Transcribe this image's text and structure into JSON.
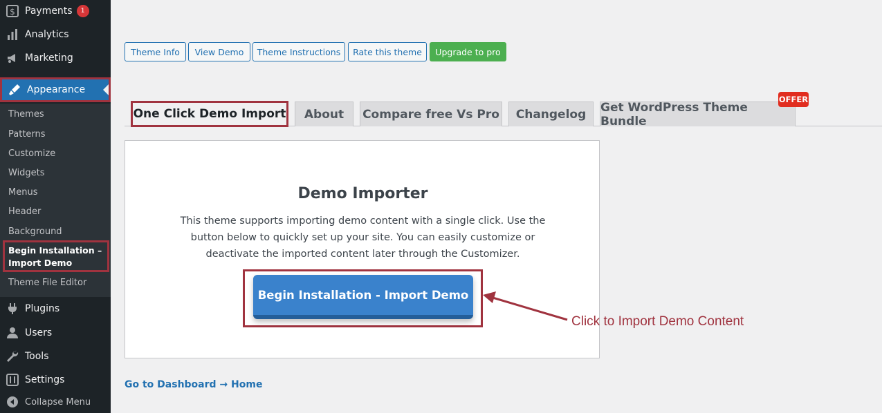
{
  "sidebar": {
    "menu": [
      {
        "label": "Payments",
        "icon": "dollar-icon",
        "badge": "1"
      },
      {
        "label": "Analytics",
        "icon": "bar-chart-icon"
      },
      {
        "label": "Marketing",
        "icon": "megaphone-icon"
      },
      {
        "label": "Appearance",
        "icon": "paintbrush-icon"
      },
      {
        "label": "Plugins",
        "icon": "plug-icon"
      },
      {
        "label": "Users",
        "icon": "user-icon"
      },
      {
        "label": "Tools",
        "icon": "wrench-icon"
      },
      {
        "label": "Settings",
        "icon": "settings-sliders-icon"
      },
      {
        "label": "Collapse Menu",
        "icon": "collapse-icon"
      }
    ],
    "submenu": [
      "Themes",
      "Patterns",
      "Customize",
      "Widgets",
      "Menus",
      "Header",
      "Background",
      "Begin Installation – Import Demo",
      "Theme File Editor"
    ]
  },
  "top_buttons": [
    "Theme Info",
    "View Demo",
    "Theme Instructions",
    "Rate this theme",
    "Upgrade to pro"
  ],
  "tabs": [
    "One Click Demo Import",
    "About",
    "Compare free Vs Pro",
    "Changelog",
    "Get WordPress Theme Bundle"
  ],
  "offer_badge": "OFFER",
  "panel": {
    "title": "Demo Importer",
    "description": "This theme supports importing demo content with a single click. Use the button below to quickly set up your site. You can easily customize or deactivate the imported content later through the Customizer.",
    "cta": "Begin Installation - Import Demo"
  },
  "callout": "Click to Import Demo Content",
  "footer_link": "Go to Dashboard → Home",
  "colors": {
    "accent": "#2271b1",
    "highlight": "#a0333f",
    "upgrade": "#4caf50",
    "offer": "#e12d1f"
  }
}
